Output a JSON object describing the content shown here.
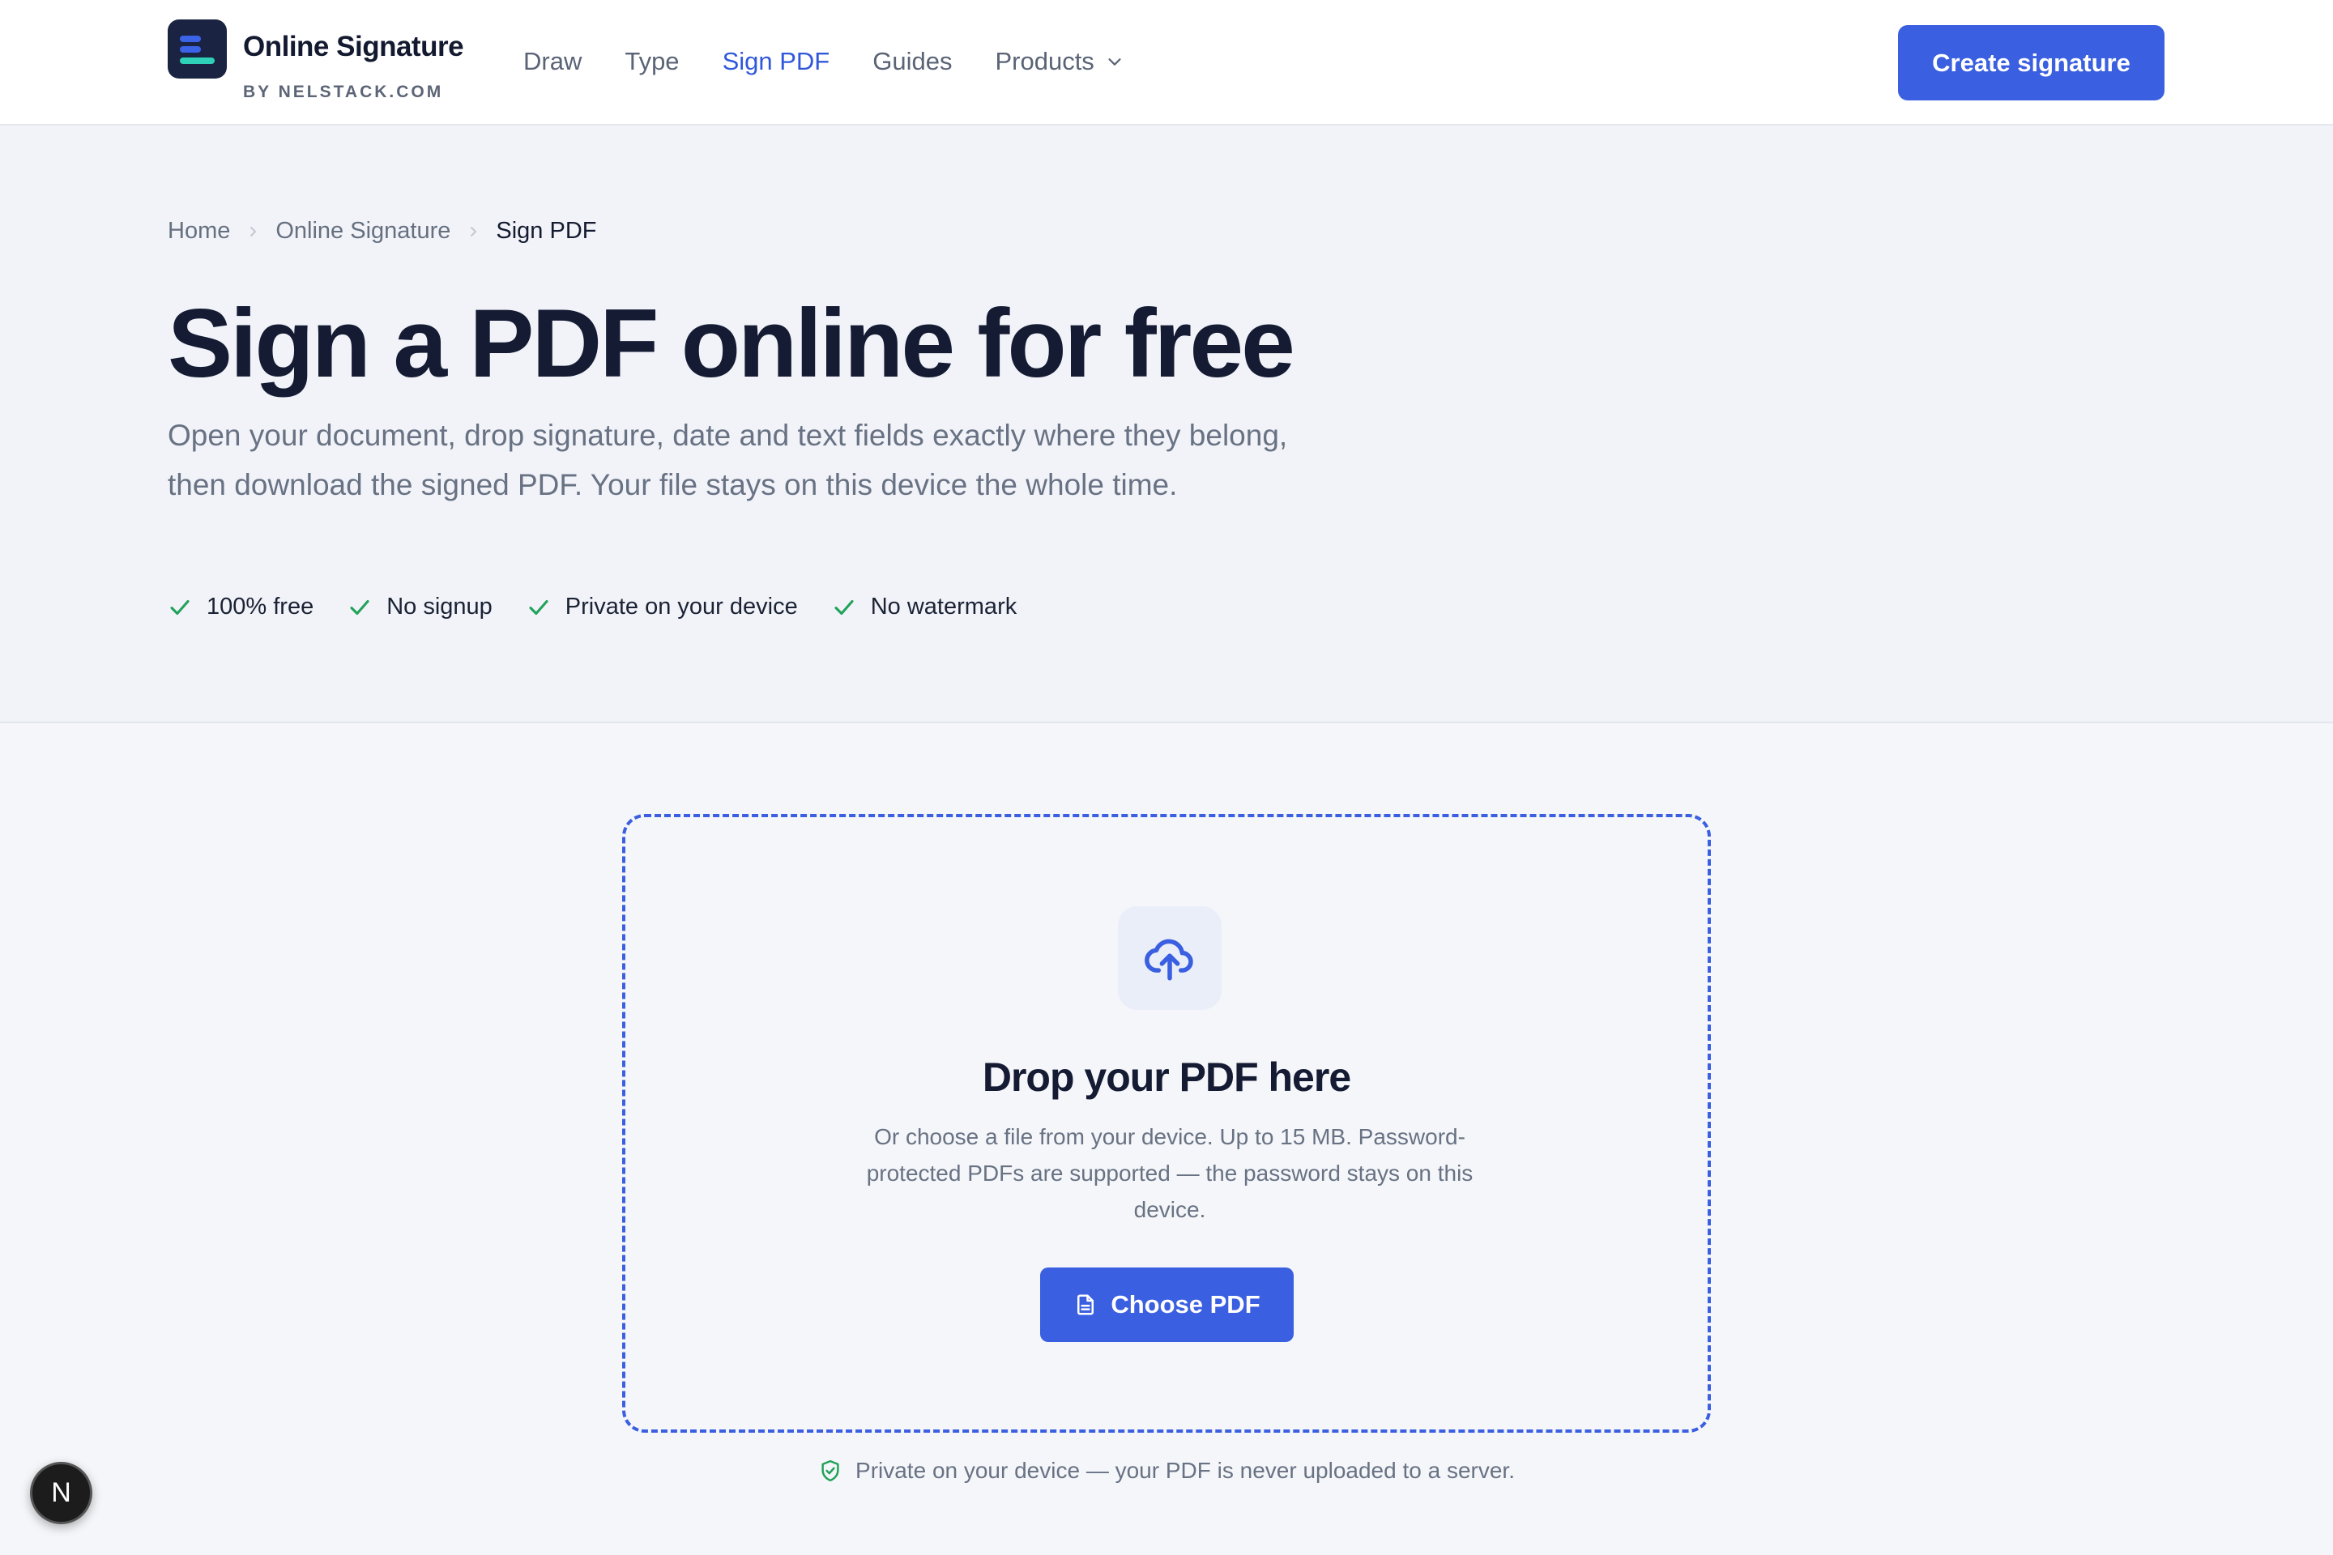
{
  "brand": {
    "name": "Online Signature",
    "byline": "BY NELSTACK.COM"
  },
  "nav": {
    "items": [
      {
        "label": "Draw",
        "active": false
      },
      {
        "label": "Type",
        "active": false
      },
      {
        "label": "Sign PDF",
        "active": true
      },
      {
        "label": "Guides",
        "active": false
      }
    ],
    "products_label": "Products",
    "cta_label": "Create signature"
  },
  "breadcrumb": [
    "Home",
    "Online Signature",
    "Sign PDF"
  ],
  "hero": {
    "title": "Sign a PDF online for free",
    "description": "Open your document, drop signature, date and text fields exactly where they belong, then download the signed PDF. Your file stays on this device the whole time.",
    "features": [
      "100% free",
      "No signup",
      "Private on your device",
      "No watermark"
    ]
  },
  "dropzone": {
    "title": "Drop your PDF here",
    "description": "Or choose a file from your device. Up to 15 MB. Password-protected PDFs are supported — the password stays on this device.",
    "button_label": "Choose PDF"
  },
  "privacy_note": "Private on your device — your PDF is never uploaded to a server.",
  "floating_badge": "N",
  "colors": {
    "accent": "#3a5fe0",
    "check_green": "#22a25a",
    "title_text": "#141b33",
    "muted_text": "#687283"
  }
}
